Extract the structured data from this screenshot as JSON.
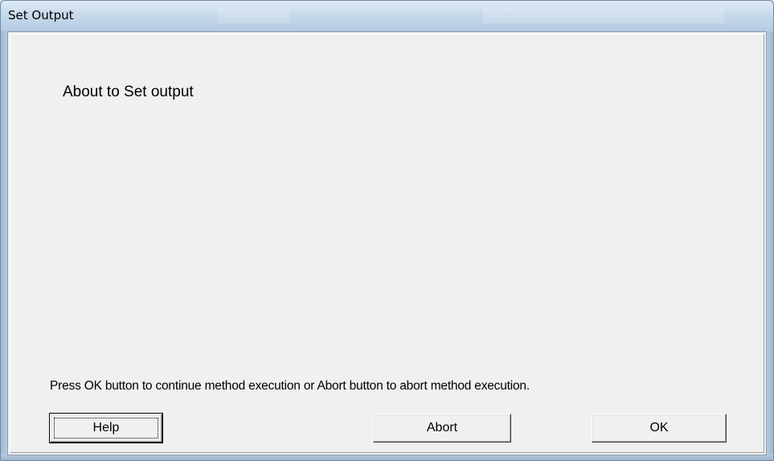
{
  "window": {
    "title": "Set Output"
  },
  "dialog": {
    "message": "About to Set output",
    "instruction": "Press OK button to continue method execution or Abort button to abort method execution."
  },
  "buttons": {
    "help_label": "Help",
    "abort_label": "Abort",
    "ok_label": "OK"
  },
  "colors": {
    "client_background": "#f0f0f0",
    "titlebar": "#c5d8ea"
  }
}
